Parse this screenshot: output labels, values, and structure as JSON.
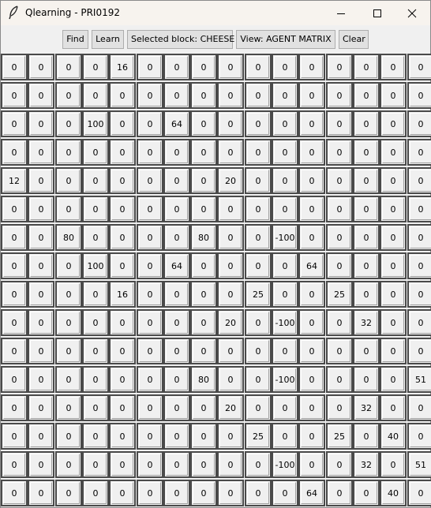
{
  "window": {
    "title": "Qlearning - PRI0192",
    "icon": "feather-icon"
  },
  "toolbar": {
    "find_label": "Find",
    "learn_label": "Learn",
    "selected_block_label": "Selected block: CHEESE",
    "view_label": "View: AGENT MATRIX",
    "clear_label": "Clear"
  },
  "grid": {
    "rows": [
      [
        "0",
        "0",
        "0",
        "0",
        "16",
        "0",
        "0",
        "0",
        "0",
        "0",
        "0",
        "0",
        "0",
        "0",
        "0",
        "0"
      ],
      [
        "0",
        "0",
        "0",
        "0",
        "0",
        "0",
        "0",
        "0",
        "0",
        "0",
        "0",
        "0",
        "0",
        "0",
        "0",
        "0"
      ],
      [
        "0",
        "0",
        "0",
        "100",
        "0",
        "0",
        "64",
        "0",
        "0",
        "0",
        "0",
        "0",
        "0",
        "0",
        "0",
        "0"
      ],
      [
        "0",
        "0",
        "0",
        "0",
        "0",
        "0",
        "0",
        "0",
        "0",
        "0",
        "0",
        "0",
        "0",
        "0",
        "0",
        "0"
      ],
      [
        "12",
        "0",
        "0",
        "0",
        "0",
        "0",
        "0",
        "0",
        "20",
        "0",
        "0",
        "0",
        "0",
        "0",
        "0",
        "0"
      ],
      [
        "0",
        "0",
        "0",
        "0",
        "0",
        "0",
        "0",
        "0",
        "0",
        "0",
        "0",
        "0",
        "0",
        "0",
        "0",
        "0"
      ],
      [
        "0",
        "0",
        "80",
        "0",
        "0",
        "0",
        "0",
        "80",
        "0",
        "0",
        "-100",
        "0",
        "0",
        "0",
        "0",
        "0"
      ],
      [
        "0",
        "0",
        "0",
        "100",
        "0",
        "0",
        "64",
        "0",
        "0",
        "0",
        "0",
        "64",
        "0",
        "0",
        "0",
        "0"
      ],
      [
        "0",
        "0",
        "0",
        "0",
        "16",
        "0",
        "0",
        "0",
        "0",
        "25",
        "0",
        "0",
        "25",
        "0",
        "0",
        "0"
      ],
      [
        "0",
        "0",
        "0",
        "0",
        "0",
        "0",
        "0",
        "0",
        "20",
        "0",
        "-100",
        "0",
        "0",
        "32",
        "0",
        "0"
      ],
      [
        "0",
        "0",
        "0",
        "0",
        "0",
        "0",
        "0",
        "0",
        "0",
        "0",
        "0",
        "0",
        "0",
        "0",
        "0",
        "0"
      ],
      [
        "0",
        "0",
        "0",
        "0",
        "0",
        "0",
        "0",
        "80",
        "0",
        "0",
        "-100",
        "0",
        "0",
        "0",
        "0",
        "51"
      ],
      [
        "0",
        "0",
        "0",
        "0",
        "0",
        "0",
        "0",
        "0",
        "20",
        "0",
        "0",
        "0",
        "0",
        "32",
        "0",
        "0"
      ],
      [
        "0",
        "0",
        "0",
        "0",
        "0",
        "0",
        "0",
        "0",
        "0",
        "25",
        "0",
        "0",
        "25",
        "0",
        "40",
        "0"
      ],
      [
        "0",
        "0",
        "0",
        "0",
        "0",
        "0",
        "0",
        "0",
        "0",
        "0",
        "-100",
        "0",
        "0",
        "32",
        "0",
        "51"
      ],
      [
        "0",
        "0",
        "0",
        "0",
        "0",
        "0",
        "0",
        "0",
        "0",
        "0",
        "0",
        "64",
        "0",
        "0",
        "40",
        "0"
      ]
    ]
  }
}
